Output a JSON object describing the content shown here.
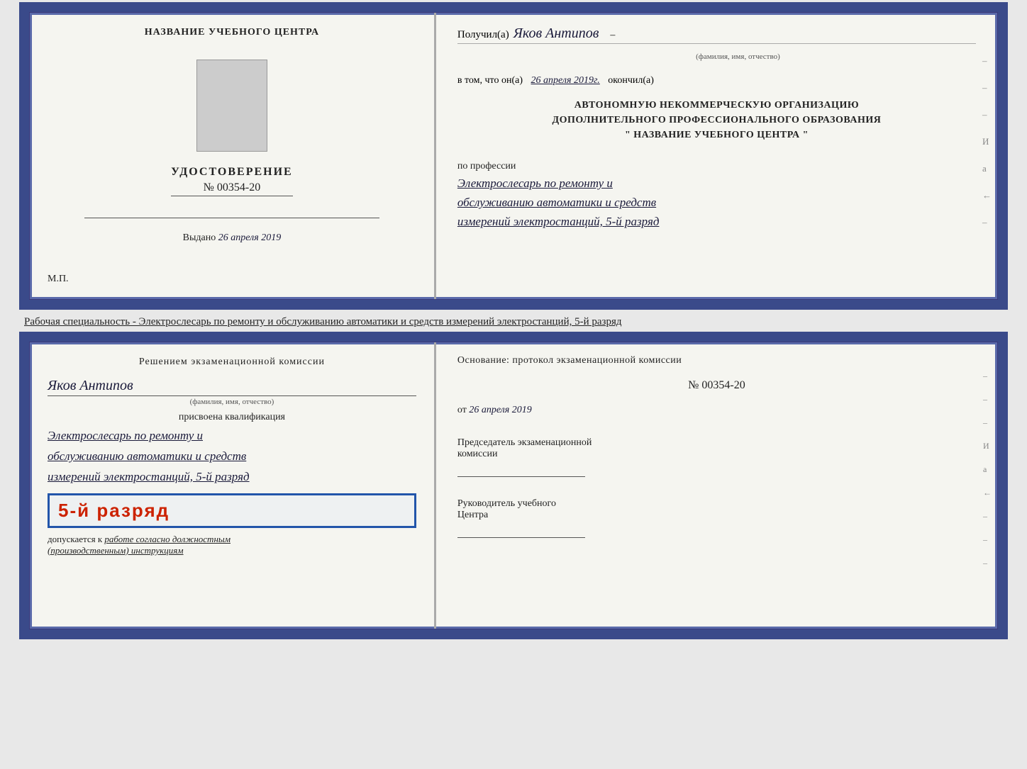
{
  "top_cert": {
    "left": {
      "org_name": "НАЗВАНИЕ УЧЕБНОГО ЦЕНТРА",
      "cert_label": "УДОСТОВЕРЕНИЕ",
      "cert_number": "№ 00354-20",
      "issued_prefix": "Выдано",
      "issued_date": "26 апреля 2019",
      "mp": "М.П."
    },
    "right": {
      "received_prefix": "Получил(а)",
      "recipient_name": "Яков Антипов",
      "fio_label": "(фамилия, имя, отчество)",
      "in_that_prefix": "в том, что он(а)",
      "in_that_date": "26 апреля 2019г.",
      "finished": "окончил(а)",
      "org_line1": "АВТОНОМНУЮ НЕКОММЕРЧЕСКУЮ ОРГАНИЗАЦИЮ",
      "org_line2": "ДОПОЛНИТЕЛЬНОГО ПРОФЕССИОНАЛЬНОГО ОБРАЗОВАНИЯ",
      "org_line3": "\"   НАЗВАНИЕ УЧЕБНОГО ЦЕНТРА   \"",
      "profession_label": "по профессии",
      "profession_line1": "Электрослесарь по ремонту и",
      "profession_line2": "обслуживанию автоматики и средств",
      "profession_line3": "измерений электростанций, 5-й разряд",
      "side_marks": [
        "-",
        "-",
        "-",
        "И",
        "а",
        "←",
        "-"
      ]
    }
  },
  "specialty_text": "Рабочая специальность - Электрослесарь по ремонту и обслуживанию автоматики и средств\nизмерений электростанций, 5-й разряд",
  "bottom_cert": {
    "left": {
      "decision_text": "Решением экзаменационной комиссии",
      "name": "Яков Антипов",
      "fio_label": "(фамилия, имя, отчество)",
      "assigned_text": "присвоена квалификация",
      "qual_line1": "Электрослесарь по ремонту и",
      "qual_line2": "обслуживанию автоматики и средств",
      "qual_line3": "измерений электростанций, 5-й разряд",
      "stamp_text": "5-й разряд",
      "allowed_prefix": "допускается к",
      "allowed_text": "работе согласно должностным",
      "allowed_italic": "(производственным) инструкциям"
    },
    "right": {
      "basis_text": "Основание: протокол экзаменационной комиссии",
      "protocol_number": "№  00354-20",
      "protocol_from": "от",
      "protocol_date": "26 апреля 2019",
      "chairman_label": "Председатель экзаменационной",
      "chairman_label2": "комиссии",
      "director_label": "Руководитель учебного",
      "director_label2": "Центра",
      "side_marks": [
        "-",
        "-",
        "-",
        "И",
        "а",
        "←",
        "-",
        "-",
        "-"
      ]
    }
  }
}
